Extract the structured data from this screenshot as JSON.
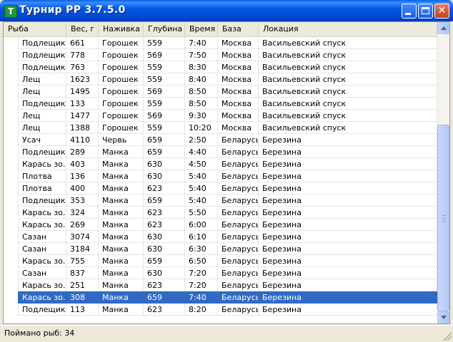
{
  "window": {
    "title": "Турнир РР 3.7.5.0",
    "icon_letter": "T",
    "icon_name": "app-icon",
    "controls": {
      "minimize": "minimize-icon",
      "maximize": "maximize-icon",
      "close": "close-icon",
      "close_glyph": "✕"
    }
  },
  "table": {
    "columns": [
      "Рыба",
      "Вес, г",
      "Наживка",
      "Глубина",
      "Время",
      "База",
      "Локация"
    ],
    "selected_row_index": 21,
    "rows": [
      [
        "Подлещик",
        "661",
        "Горошек",
        "559",
        "7:40",
        "Москва",
        "Васильевский спуск"
      ],
      [
        "Подлещик",
        "778",
        "Горошек",
        "569",
        "7:50",
        "Москва",
        "Васильевский спуск"
      ],
      [
        "Подлещик",
        "763",
        "Горошек",
        "559",
        "8:30",
        "Москва",
        "Васильевский спуск"
      ],
      [
        "Лещ",
        "1623",
        "Горошек",
        "559",
        "8:40",
        "Москва",
        "Васильевский спуск"
      ],
      [
        "Лещ",
        "1495",
        "Горошек",
        "569",
        "8:50",
        "Москва",
        "Васильевский спуск"
      ],
      [
        "Подлещик",
        "133",
        "Горошек",
        "559",
        "8:50",
        "Москва",
        "Васильевский спуск"
      ],
      [
        "Лещ",
        "1477",
        "Горошек",
        "569",
        "9:30",
        "Москва",
        "Васильевский спуск"
      ],
      [
        "Лещ",
        "1388",
        "Горошек",
        "559",
        "10:20",
        "Москва",
        "Васильевский спуск"
      ],
      [
        "Усач",
        "4110",
        "Червь",
        "659",
        "2:50",
        "Беларусь",
        "Березина"
      ],
      [
        "Подлещик",
        "289",
        "Манка",
        "659",
        "4:40",
        "Беларусь",
        "Березина"
      ],
      [
        "Карась зо...",
        "403",
        "Манка",
        "630",
        "4:50",
        "Беларусь",
        "Березина"
      ],
      [
        "Плотва",
        "136",
        "Манка",
        "630",
        "5:40",
        "Беларусь",
        "Березина"
      ],
      [
        "Плотва",
        "400",
        "Манка",
        "623",
        "5:40",
        "Беларусь",
        "Березина"
      ],
      [
        "Подлещик",
        "353",
        "Манка",
        "659",
        "5:40",
        "Беларусь",
        "Березина"
      ],
      [
        "Карась зо...",
        "324",
        "Манка",
        "623",
        "5:50",
        "Беларусь",
        "Березина"
      ],
      [
        "Карась зо...",
        "269",
        "Манка",
        "623",
        "6:00",
        "Беларусь",
        "Березина"
      ],
      [
        "Сазан",
        "3074",
        "Манка",
        "630",
        "6:10",
        "Беларусь",
        "Березина"
      ],
      [
        "Сазан",
        "3184",
        "Манка",
        "630",
        "6:30",
        "Беларусь",
        "Березина"
      ],
      [
        "Карась зо...",
        "755",
        "Манка",
        "659",
        "6:50",
        "Беларусь",
        "Березина"
      ],
      [
        "Сазан",
        "837",
        "Манка",
        "630",
        "7:20",
        "Беларусь",
        "Березина"
      ],
      [
        "Карась зо...",
        "251",
        "Манка",
        "623",
        "7:20",
        "Беларусь",
        "Березина"
      ],
      [
        "Карась зо...",
        "308",
        "Манка",
        "659",
        "7:40",
        "Беларусь",
        "Березина"
      ],
      [
        "Подлещик",
        "113",
        "Манка",
        "623",
        "8:20",
        "Беларусь",
        "Березина"
      ]
    ]
  },
  "scrollbar": {
    "up_icon": "scroll-up-arrow-icon",
    "down_icon": "scroll-down-arrow-icon",
    "scroll_position": 1.0
  },
  "status": {
    "text": "Поймано рыб: 34"
  },
  "colors": {
    "title_bar": "#0054e3",
    "selection": "#316ac5",
    "close_button": "#d4532c"
  }
}
